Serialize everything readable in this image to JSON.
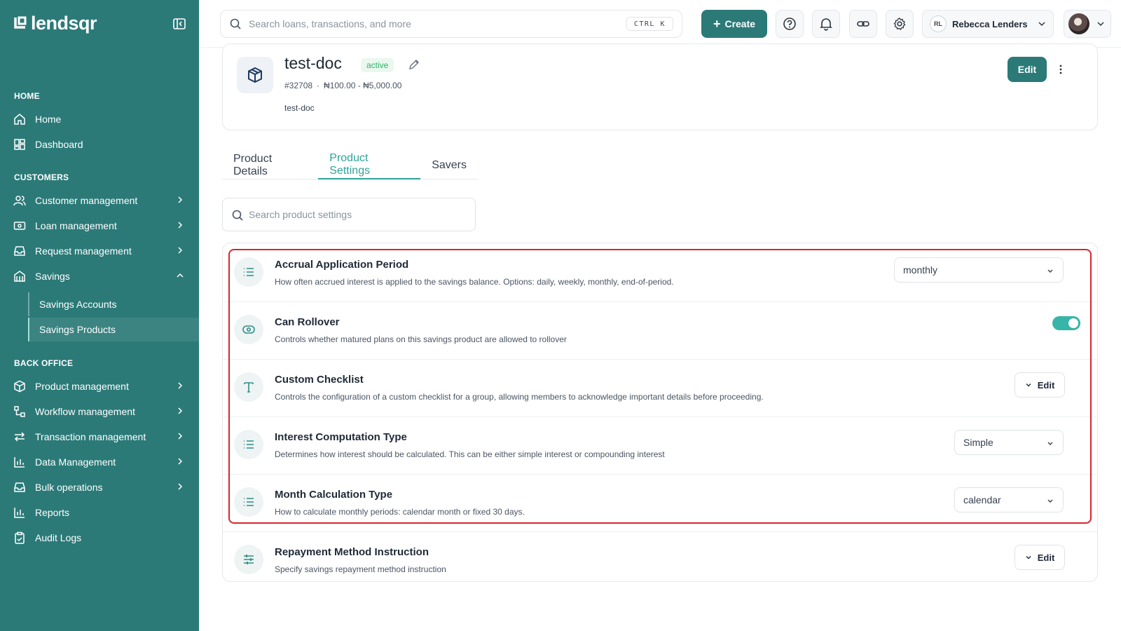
{
  "app": {
    "logo_text": "lendsqr"
  },
  "sidebar": {
    "sections": {
      "home": "HOME",
      "customers": "CUSTOMERS",
      "back_office": "BACK OFFICE"
    },
    "items": {
      "home": "Home",
      "dashboard": "Dashboard",
      "customer_management": "Customer management",
      "loan_management": "Loan management",
      "request_management": "Request management",
      "savings": "Savings",
      "savings_accounts": "Savings Accounts",
      "savings_products": "Savings Products",
      "product_management": "Product management",
      "workflow_management": "Workflow management",
      "transaction_management": "Transaction management",
      "data_management": "Data Management",
      "bulk_operations": "Bulk operations",
      "reports": "Reports",
      "audit_logs": "Audit Logs"
    }
  },
  "topbar": {
    "search_placeholder": "Search loans, transactions, and more",
    "shortcut": "CTRL K",
    "create_label": "Create",
    "org_initials": "RL",
    "org_name": "Rebecca Lenders"
  },
  "product": {
    "name": "test-doc",
    "status": "active",
    "id": "#32708",
    "range": "₦100.00 - ₦5,000.00",
    "description": "test-doc",
    "edit_label": "Edit"
  },
  "tabs": [
    "Product Details",
    "Product Settings",
    "Savers"
  ],
  "settings_search_placeholder": "Search product settings",
  "settings": [
    {
      "title": "Accrual Application Period",
      "description": "How often accrued interest is applied to the savings balance. Options: daily, weekly, monthly, end-of-period.",
      "control": "select",
      "value": "monthly"
    },
    {
      "title": "Can Rollover",
      "description": "Controls whether matured plans on this savings product are allowed to rollover",
      "control": "toggle",
      "value": true
    },
    {
      "title": "Custom Checklist",
      "description": "Controls the configuration of a custom checklist for a group, allowing members to acknowledge important details before proceeding.",
      "control": "edit",
      "button_label": "Edit"
    },
    {
      "title": "Interest Computation Type",
      "description": "Determines how interest should be calculated. This can be either simple interest or compounding interest",
      "control": "select",
      "value": "Simple"
    },
    {
      "title": "Month Calculation Type",
      "description": "How to calculate monthly periods: calendar month or fixed 30 days.",
      "control": "select",
      "value": "calendar"
    },
    {
      "title": "Repayment Method Instruction",
      "description": "Specify savings repayment method instruction",
      "control": "edit",
      "button_label": "Edit"
    }
  ],
  "colors": {
    "brand": "#2b7a78",
    "accent": "#2ea39a",
    "highlight_border": "#d8262f",
    "toggle_on": "#36b5a8"
  }
}
